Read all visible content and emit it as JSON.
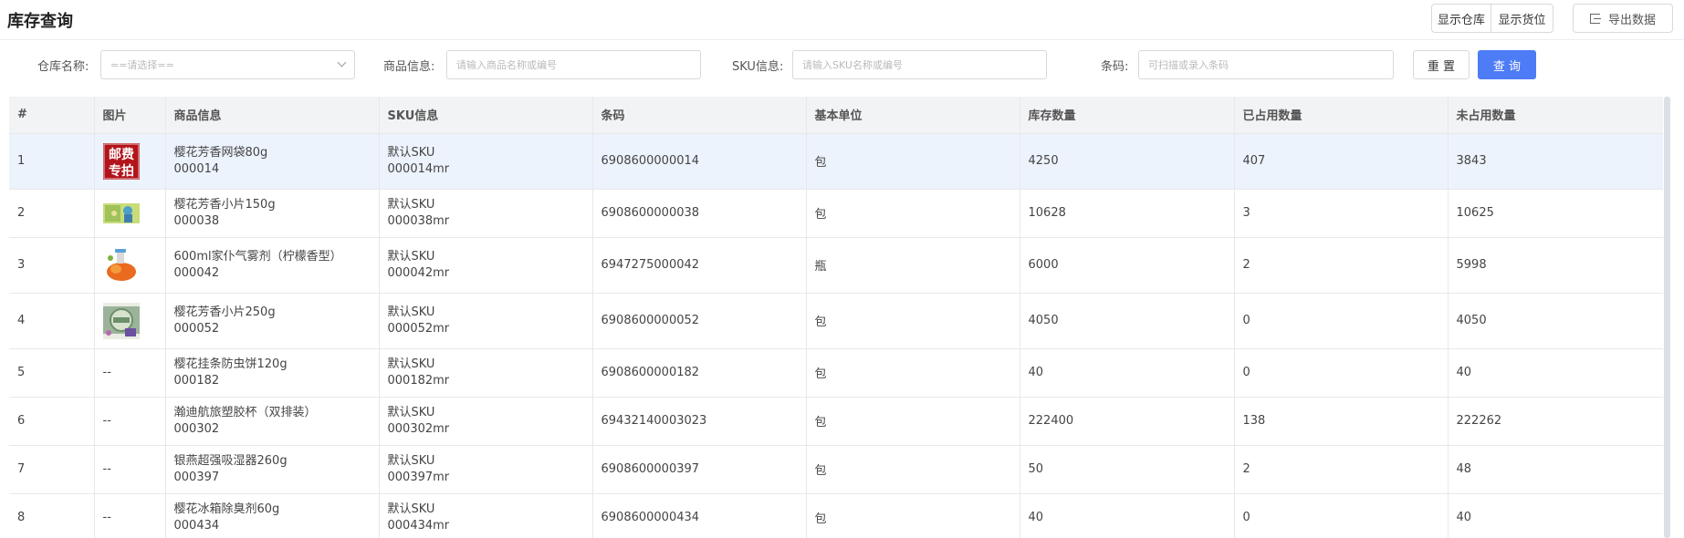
{
  "header": {
    "title": "库存查询",
    "show_warehouse": "显示仓库",
    "show_location": "显示货位",
    "export": "导出数据"
  },
  "filters": {
    "warehouse_label": "仓库名称:",
    "warehouse_placeholder": "==请选择==",
    "product_label": "商品信息:",
    "product_placeholder": "请输入商品名称或编号",
    "sku_label": "SKU信息:",
    "sku_placeholder": "请输入SKU名称或编号",
    "barcode_label": "条码:",
    "barcode_placeholder": "可扫描或录入条码",
    "reset": "重 置",
    "query": "查 询"
  },
  "table": {
    "columns": [
      "#",
      "图片",
      "商品信息",
      "SKU信息",
      "条码",
      "基本单位",
      "库存数量",
      "已占用数量",
      "未占用数量"
    ],
    "rows": [
      {
        "idx": "1",
        "image": "postage-sticker",
        "name": "樱花芳香网袋80g",
        "code": "000014",
        "sku_name": "默认SKU",
        "sku_code": "000014mr",
        "barcode": "6908600000014",
        "unit": "包",
        "stock": "4250",
        "occupied": "407",
        "free": "3843"
      },
      {
        "idx": "2",
        "image": "air-freshener-pack",
        "name": "樱花芳香小片150g",
        "code": "000038",
        "sku_name": "默认SKU",
        "sku_code": "000038mr",
        "barcode": "6908600000038",
        "unit": "包",
        "stock": "10628",
        "occupied": "3",
        "free": "10625"
      },
      {
        "idx": "3",
        "image": "orange-spray-bottle",
        "name": "600ml家仆气雾剂（柠檬香型）",
        "code": "000042",
        "sku_name": "默认SKU",
        "sku_code": "000042mr",
        "barcode": "6947275000042",
        "unit": "瓶",
        "stock": "6000",
        "occupied": "2",
        "free": "5998"
      },
      {
        "idx": "4",
        "image": "air-freshener-box",
        "name": "樱花芳香小片250g",
        "code": "000052",
        "sku_name": "默认SKU",
        "sku_code": "000052mr",
        "barcode": "6908600000052",
        "unit": "包",
        "stock": "4050",
        "occupied": "0",
        "free": "4050"
      },
      {
        "idx": "5",
        "image": "",
        "image_text": "--",
        "name": "樱花挂条防虫饼120g",
        "code": "000182",
        "sku_name": "默认SKU",
        "sku_code": "000182mr",
        "barcode": "6908600000182",
        "unit": "包",
        "stock": "40",
        "occupied": "0",
        "free": "40"
      },
      {
        "idx": "6",
        "image": "",
        "image_text": "--",
        "name": "瀚迪航旅塑胶杯（双排装）",
        "code": "000302",
        "sku_name": "默认SKU",
        "sku_code": "000302mr",
        "barcode": "69432140003023",
        "unit": "包",
        "stock": "222400",
        "occupied": "138",
        "free": "222262"
      },
      {
        "idx": "7",
        "image": "",
        "image_text": "--",
        "name": "银燕超强吸湿器260g",
        "code": "000397",
        "sku_name": "默认SKU",
        "sku_code": "000397mr",
        "barcode": "6908600000397",
        "unit": "包",
        "stock": "50",
        "occupied": "2",
        "free": "48"
      },
      {
        "idx": "8",
        "image": "",
        "image_text": "--",
        "name": "樱花冰箱除臭剂60g",
        "code": "000434",
        "sku_name": "默认SKU",
        "sku_code": "000434mr",
        "barcode": "6908600000434",
        "unit": "包",
        "stock": "40",
        "occupied": "0",
        "free": "40"
      }
    ]
  },
  "thumb_text": {
    "line1": "邮费",
    "line2": "专拍"
  },
  "colors": {
    "primary": "#4d7cf6",
    "row_highlight": "#edf3fd",
    "header_bg": "#f2f3f5",
    "postage_red": "#b3141c"
  }
}
